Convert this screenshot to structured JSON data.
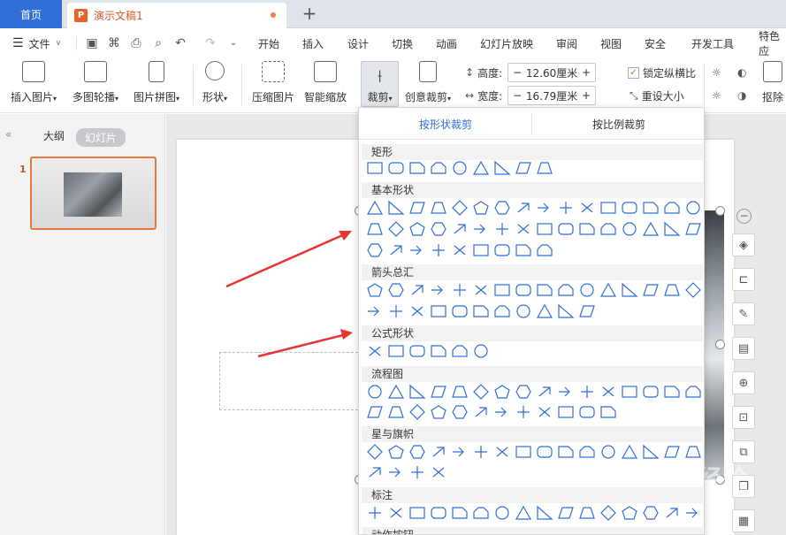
{
  "tabs": {
    "home": "首页",
    "doc": "演示文稿1",
    "doc_icon": "P",
    "new": "+"
  },
  "menu": {
    "file": "文件",
    "items": [
      "开始",
      "插入",
      "设计",
      "切换",
      "动画",
      "幻灯片放映",
      "审阅",
      "视图",
      "安全",
      "开发工具",
      "特色应"
    ]
  },
  "ribbon": {
    "insert_picture": "插入图片",
    "multi_carousel": "多图轮播",
    "picture_collage": "图片拼图",
    "shape": "形状",
    "compress": "压缩图片",
    "smart_zoom": "智能缩放",
    "crop": "裁剪",
    "creative_crop": "创意裁剪",
    "height_label": "高度:",
    "height_value": "12.60厘米",
    "width_label": "宽度:",
    "width_value": "16.79厘米",
    "lock_ratio": "锁定纵横比",
    "reset_size": "重设大小",
    "cutout": "抠除"
  },
  "left_panel": {
    "outline": "大纲",
    "slides": "幻灯片",
    "slide_number": "1"
  },
  "dropdown": {
    "tab_shape": "按形状裁剪",
    "tab_ratio": "按比例裁剪",
    "sections": [
      "矩形",
      "基本形状",
      "箭头总汇",
      "公式形状",
      "流程图",
      "星与旗帜",
      "标注",
      "动作按钮"
    ]
  },
  "watermark": "Bai du 经验",
  "colors": {
    "accent": "#2f6fd6",
    "doc_orange": "#e8612c",
    "arrow_red": "#e8342f",
    "shape_stroke": "#2f6fd6"
  }
}
